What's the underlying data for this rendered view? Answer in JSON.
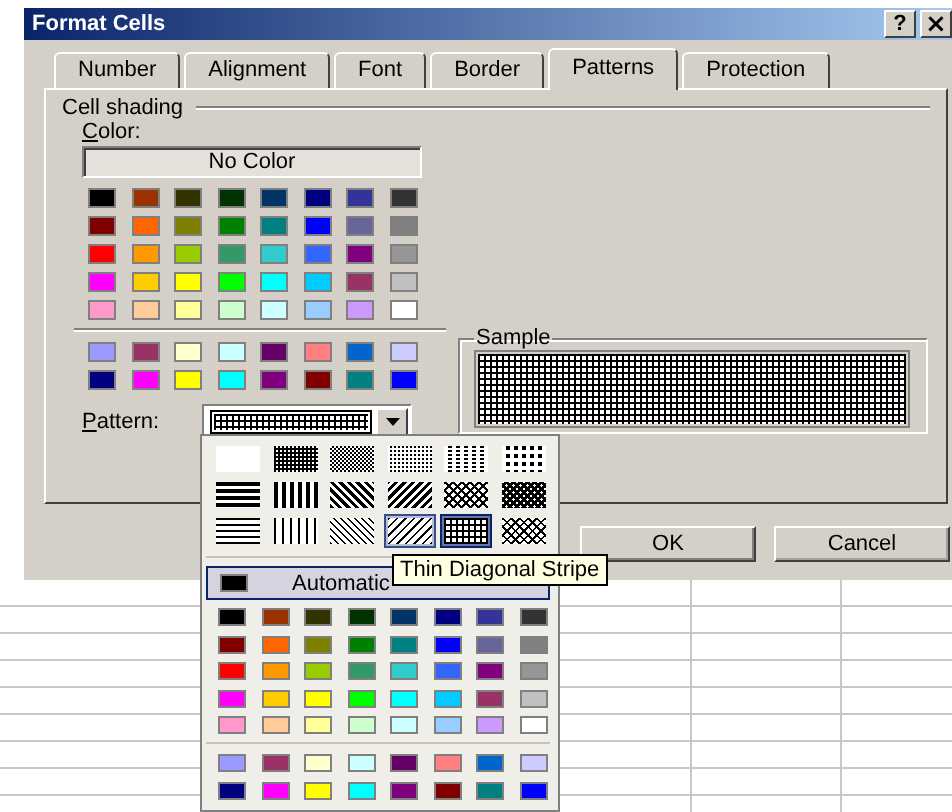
{
  "window": {
    "title": "Format Cells",
    "buttons": [
      {
        "kind": "help",
        "label": "?"
      },
      {
        "kind": "close",
        "label": "×"
      }
    ]
  },
  "tabs": [
    {
      "label": "Number",
      "selected": false
    },
    {
      "label": "Alignment",
      "selected": false
    },
    {
      "label": "Font",
      "selected": false
    },
    {
      "label": "Border",
      "selected": false
    },
    {
      "label": "Patterns",
      "selected": true
    },
    {
      "label": "Protection",
      "selected": false
    }
  ],
  "cell_shading": {
    "heading": "Cell shading",
    "color_label": "Color:",
    "no_color_button": "No Color",
    "swatches": [
      {
        "color": "#000000"
      },
      {
        "color": "#993300"
      },
      {
        "color": "#333300"
      },
      {
        "color": "#003300"
      },
      {
        "color": "#003366"
      },
      {
        "color": "#000080"
      },
      {
        "color": "#333399"
      },
      {
        "color": "#333333"
      },
      {
        "color": "#800000"
      },
      {
        "color": "#ff6600"
      },
      {
        "color": "#808000"
      },
      {
        "color": "#008000"
      },
      {
        "color": "#008080"
      },
      {
        "color": "#0000ff"
      },
      {
        "color": "#666699"
      },
      {
        "color": "#808080"
      },
      {
        "color": "#ff0000"
      },
      {
        "color": "#ff9900"
      },
      {
        "color": "#99cc00"
      },
      {
        "color": "#339966"
      },
      {
        "color": "#33cccc"
      },
      {
        "color": "#3366ff"
      },
      {
        "color": "#800080"
      },
      {
        "color": "#969696"
      },
      {
        "color": "#ff00ff"
      },
      {
        "color": "#ffcc00"
      },
      {
        "color": "#ffff00"
      },
      {
        "color": "#00ff00"
      },
      {
        "color": "#00ffff"
      },
      {
        "color": "#00ccff"
      },
      {
        "color": "#993366"
      },
      {
        "color": "#c0c0c0"
      },
      {
        "color": "#ff99cc"
      },
      {
        "color": "#ffcc99"
      },
      {
        "color": "#ffff99"
      },
      {
        "color": "#ccffcc"
      },
      {
        "color": "#ccffff"
      },
      {
        "color": "#99ccff"
      },
      {
        "color": "#cc99ff"
      },
      {
        "color": "#ffffff"
      }
    ],
    "chart_swatches": [
      {
        "color": "#9999ff"
      },
      {
        "color": "#993366"
      },
      {
        "color": "#ffffcc"
      },
      {
        "color": "#ccffff"
      },
      {
        "color": "#660066"
      },
      {
        "color": "#ff8080"
      },
      {
        "color": "#0066cc"
      },
      {
        "color": "#ccccff"
      },
      {
        "color": "#000080"
      },
      {
        "color": "#ff00ff"
      },
      {
        "color": "#ffff00"
      },
      {
        "color": "#00ffff"
      },
      {
        "color": "#800080"
      },
      {
        "color": "#800000"
      },
      {
        "color": "#008080"
      },
      {
        "color": "#0000ff"
      }
    ],
    "pattern_label": "Pattern:"
  },
  "sample": {
    "heading": "Sample"
  },
  "buttons": [
    {
      "kind": "ok",
      "label": "OK"
    },
    {
      "kind": "cancel",
      "label": "Cancel"
    }
  ],
  "pattern_dropdown": {
    "patterns": [
      {
        "kind": "solid",
        "selected": false,
        "hovered": false
      },
      {
        "kind": "gray75",
        "selected": false,
        "hovered": false
      },
      {
        "kind": "gray50",
        "selected": false,
        "hovered": false
      },
      {
        "kind": "gray25",
        "selected": false,
        "hovered": false
      },
      {
        "kind": "gray12",
        "selected": false,
        "hovered": false
      },
      {
        "kind": "gray6",
        "selected": false,
        "hovered": false
      },
      {
        "kind": "horizontal",
        "selected": false,
        "hovered": false
      },
      {
        "kind": "vertical",
        "selected": false,
        "hovered": false
      },
      {
        "kind": "reverse_diagonal",
        "selected": false,
        "hovered": false
      },
      {
        "kind": "diagonal",
        "selected": false,
        "hovered": false
      },
      {
        "kind": "diagonal_crosshatch",
        "selected": false,
        "hovered": false
      },
      {
        "kind": "thick_diagonal_crosshatch",
        "selected": false,
        "hovered": false
      },
      {
        "kind": "thin_horizontal",
        "selected": false,
        "hovered": false
      },
      {
        "kind": "thin_vertical",
        "selected": false,
        "hovered": false
      },
      {
        "kind": "thin_reverse_diagonal",
        "selected": false,
        "hovered": false
      },
      {
        "kind": "thin_diagonal",
        "selected": false,
        "hovered": true
      },
      {
        "kind": "thin_horizontal_crosshatch",
        "selected": true,
        "hovered": false
      },
      {
        "kind": "thin_diagonal_crosshatch",
        "selected": false,
        "hovered": false
      }
    ],
    "tooltip": "Thin Diagonal Stripe",
    "automatic_button": "Automatic",
    "swatches": [
      {
        "color": "#000000"
      },
      {
        "color": "#993300"
      },
      {
        "color": "#333300"
      },
      {
        "color": "#003300"
      },
      {
        "color": "#003366"
      },
      {
        "color": "#000080"
      },
      {
        "color": "#333399"
      },
      {
        "color": "#333333"
      },
      {
        "color": "#800000"
      },
      {
        "color": "#ff6600"
      },
      {
        "color": "#808000"
      },
      {
        "color": "#008000"
      },
      {
        "color": "#008080"
      },
      {
        "color": "#0000ff"
      },
      {
        "color": "#666699"
      },
      {
        "color": "#808080"
      },
      {
        "color": "#ff0000"
      },
      {
        "color": "#ff9900"
      },
      {
        "color": "#99cc00"
      },
      {
        "color": "#339966"
      },
      {
        "color": "#33cccc"
      },
      {
        "color": "#3366ff"
      },
      {
        "color": "#800080"
      },
      {
        "color": "#969696"
      },
      {
        "color": "#ff00ff"
      },
      {
        "color": "#ffcc00"
      },
      {
        "color": "#ffff00"
      },
      {
        "color": "#00ff00"
      },
      {
        "color": "#00ffff"
      },
      {
        "color": "#00ccff"
      },
      {
        "color": "#993366"
      },
      {
        "color": "#c0c0c0"
      },
      {
        "color": "#ff99cc"
      },
      {
        "color": "#ffcc99"
      },
      {
        "color": "#ffff99"
      },
      {
        "color": "#ccffcc"
      },
      {
        "color": "#ccffff"
      },
      {
        "color": "#99ccff"
      },
      {
        "color": "#cc99ff"
      },
      {
        "color": "#ffffff"
      }
    ],
    "chart_swatches": [
      {
        "color": "#9999ff"
      },
      {
        "color": "#993366"
      },
      {
        "color": "#ffffcc"
      },
      {
        "color": "#ccffff"
      },
      {
        "color": "#660066"
      },
      {
        "color": "#ff8080"
      },
      {
        "color": "#0066cc"
      },
      {
        "color": "#ccccff"
      },
      {
        "color": "#000080"
      },
      {
        "color": "#ff00ff"
      },
      {
        "color": "#ffff00"
      },
      {
        "color": "#00ffff"
      },
      {
        "color": "#800080"
      },
      {
        "color": "#800000"
      },
      {
        "color": "#008080"
      },
      {
        "color": "#0000ff"
      }
    ]
  }
}
